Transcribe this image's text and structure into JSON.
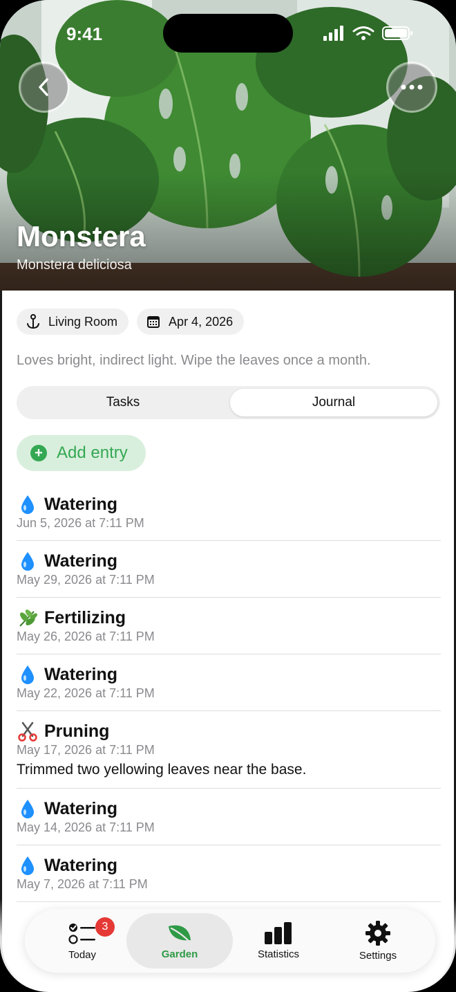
{
  "status_bar": {
    "time": "9:41"
  },
  "plant": {
    "name": "Monstera",
    "scientific_name": "Monstera deliciosa",
    "location": "Living Room",
    "date": "Apr 4, 2026",
    "description": "Loves bright, indirect light. Wipe the leaves once a month."
  },
  "segments": {
    "tasks": "Tasks",
    "journal": "Journal",
    "selected": "Journal"
  },
  "add_entry_label": "Add entry",
  "entries": [
    {
      "icon": "water-drop-icon",
      "title": "Watering",
      "date": "Jun 5, 2026 at 7:11 PM"
    },
    {
      "icon": "water-drop-icon",
      "title": "Watering",
      "date": "May 29, 2026 at 7:11 PM"
    },
    {
      "icon": "herb-icon",
      "title": "Fertilizing",
      "date": "May 26, 2026 at 7:11 PM"
    },
    {
      "icon": "water-drop-icon",
      "title": "Watering",
      "date": "May 22, 2026 at 7:11 PM"
    },
    {
      "icon": "scissors-icon",
      "title": "Pruning",
      "date": "May 17, 2026 at 7:11 PM",
      "note": "Trimmed two yellowing leaves near the base."
    },
    {
      "icon": "water-drop-icon",
      "title": "Watering",
      "date": "May 14, 2026 at 7:11 PM"
    },
    {
      "icon": "water-drop-icon",
      "title": "Watering",
      "date": "May 7, 2026 at 7:11 PM"
    }
  ],
  "tabbar": {
    "today": "Today",
    "today_badge": "3",
    "garden": "Garden",
    "statistics": "Statistics",
    "settings": "Settings",
    "selected": "Garden"
  },
  "colors": {
    "accent_green": "#34a853",
    "badge_red": "#e53935"
  }
}
